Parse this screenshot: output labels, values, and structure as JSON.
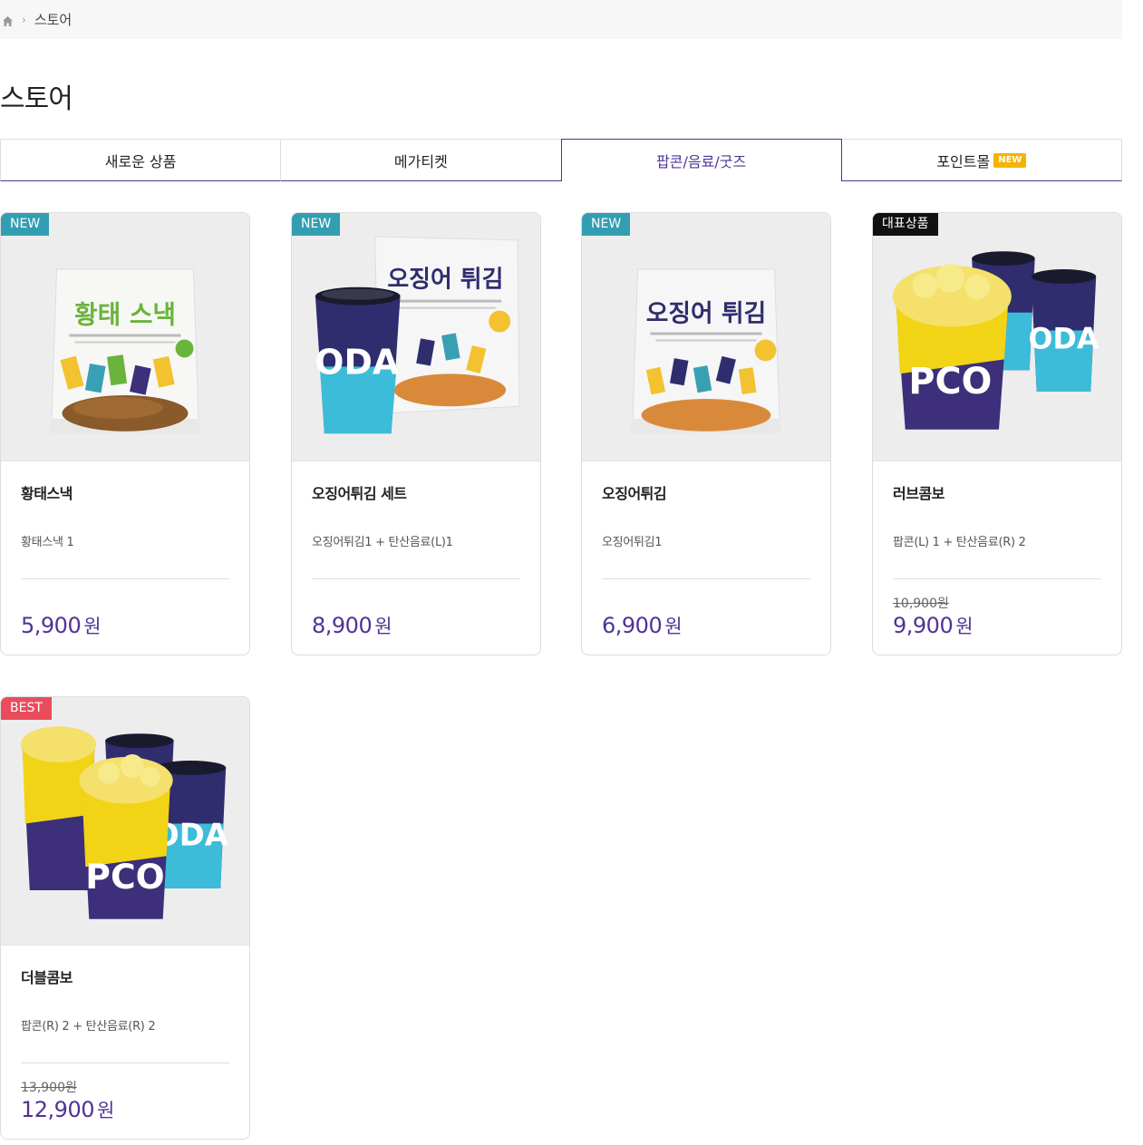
{
  "breadcrumb": {
    "current": "스토어"
  },
  "page_title": "스토어",
  "tabs": [
    {
      "label": "새로운 상품",
      "active": false
    },
    {
      "label": "메가티켓",
      "active": false
    },
    {
      "label": "팝콘/음료/굿즈",
      "active": true
    },
    {
      "label": "포인트몰",
      "active": false,
      "badge": "NEW"
    }
  ],
  "products": [
    {
      "label": "NEW",
      "name": "황태스낵",
      "desc": "황태스낵 1",
      "orig_price": "",
      "price": "5,900",
      "currency": "원"
    },
    {
      "label": "NEW",
      "name": "오징어튀김 세트",
      "desc": "오징어튀김1 + 탄산음료(L)1",
      "orig_price": "",
      "price": "8,900",
      "currency": "원"
    },
    {
      "label": "NEW",
      "name": "오징어튀김",
      "desc": "오징어튀김1",
      "orig_price": "",
      "price": "6,900",
      "currency": "원"
    },
    {
      "label": "대표상품",
      "name": "러브콤보",
      "desc": "팝콘(L) 1 + 탄산음료(R) 2",
      "orig_price": "10,900원",
      "price": "9,900",
      "currency": "원"
    },
    {
      "label": "BEST",
      "name": "더블콤보",
      "desc": "팝콘(R) 2 + 탄산음료(R) 2",
      "orig_price": "13,900원",
      "price": "12,900",
      "currency": "원"
    }
  ],
  "image_text": {
    "pollack_title": "황태 스낵",
    "squid_title": "오징어 튀김",
    "cup_soda": "ODA",
    "cup_popcorn": "PCO"
  },
  "colors": {
    "accent": "#503396",
    "new_label": "#339eb2",
    "best_label": "#e94d5c",
    "rep_label": "#111111",
    "badge": "#f5b400"
  }
}
